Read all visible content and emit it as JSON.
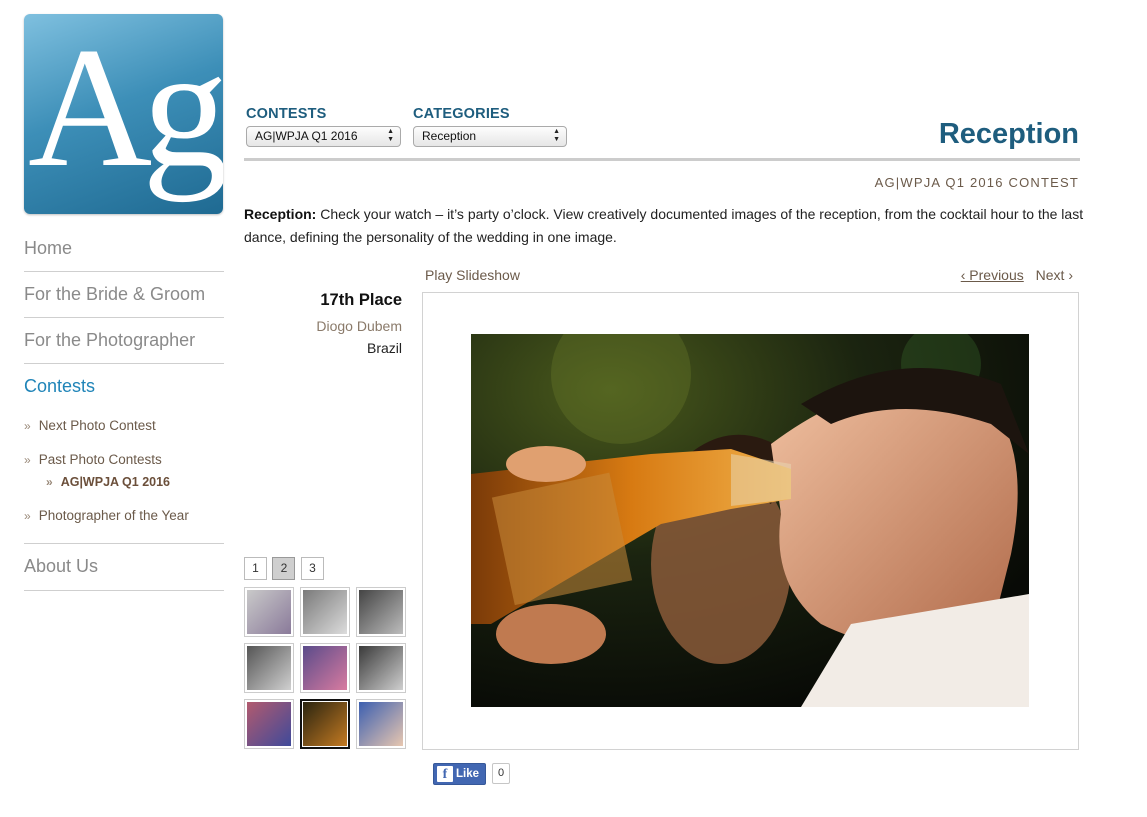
{
  "logo": {
    "text": "Ag"
  },
  "nav": {
    "items": [
      {
        "label": "Home"
      },
      {
        "label": "For the Bride & Groom"
      },
      {
        "label": "For the Photographer"
      },
      {
        "label": "Contests"
      }
    ],
    "contest_sub": [
      {
        "label": "Next Photo Contest"
      },
      {
        "label": "Past Photo Contests"
      },
      {
        "label": "AG|WPJA Q1 2016"
      },
      {
        "label": "Photographer of the Year"
      }
    ],
    "about": {
      "label": "About Us"
    },
    "bullet": "»"
  },
  "filters": {
    "contests": {
      "label": "CONTESTS",
      "value": "AG|WPJA Q1 2016"
    },
    "categories": {
      "label": "CATEGORIES",
      "value": "Reception"
    }
  },
  "page": {
    "title": "Reception",
    "contest_label": "AG|WPJA Q1 2016 CONTEST",
    "desc_bold": "Reception:",
    "desc_text": " Check your watch – it’s party o’clock. View creatively documented images of the reception, from the cocktail hour to the last dance, defining the personality of the wedding in one image."
  },
  "viewer": {
    "play_label": "Play Slideshow",
    "prev_label": "‹ Previous",
    "next_label": "Next ›"
  },
  "placement": {
    "place": "17th Place",
    "photographer": "Diogo Dubem",
    "country": "Brazil"
  },
  "thumb_pages": {
    "pages": [
      "1",
      "2",
      "3"
    ],
    "current": "2"
  },
  "thumbnails": [
    {
      "colors": [
        "#c9c9c9",
        "#8a7a9a"
      ]
    },
    {
      "colors": [
        "#7a7a7a",
        "#dcdcdc"
      ]
    },
    {
      "colors": [
        "#444444",
        "#bdbdbd"
      ]
    },
    {
      "colors": [
        "#555555",
        "#d0d0d0"
      ]
    },
    {
      "colors": [
        "#5a4b8a",
        "#d87ba0"
      ]
    },
    {
      "colors": [
        "#3a3a3a",
        "#cfcfcf"
      ]
    },
    {
      "colors": [
        "#b25a6e",
        "#3f4a9a"
      ]
    },
    {
      "colors": [
        "#2a2410",
        "#c47a22"
      ]
    },
    {
      "colors": [
        "#3c5fb0",
        "#e8c7b0"
      ]
    }
  ],
  "social": {
    "like_label": "Like",
    "like_count": "0",
    "fb_brand": "#4267b2"
  },
  "colors": {
    "heading": "#1e5d7e",
    "active_link": "#1f84b8",
    "nav_text": "#8a8a8a",
    "brown_text": "#6b5a4a"
  }
}
